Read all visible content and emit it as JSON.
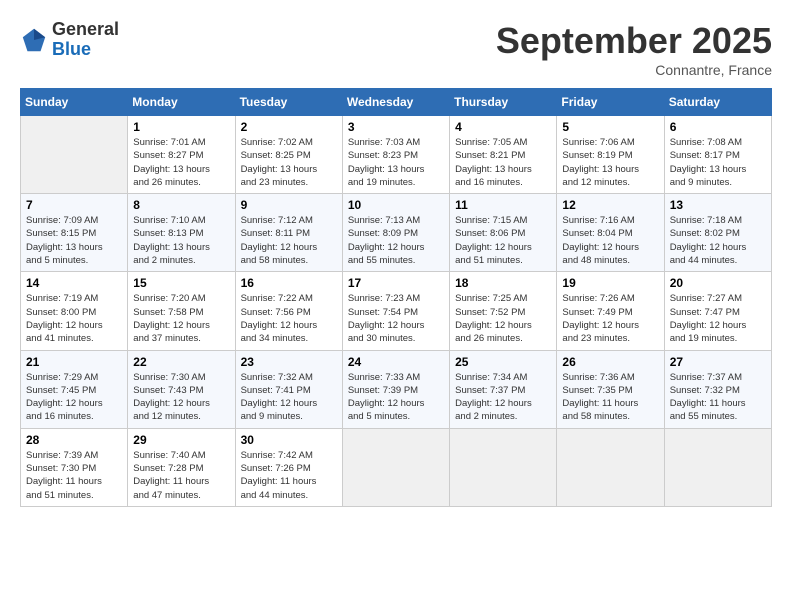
{
  "header": {
    "logo": {
      "general": "General",
      "blue": "Blue"
    },
    "title": "September 2025",
    "location": "Connantre, France"
  },
  "weekdays": [
    "Sunday",
    "Monday",
    "Tuesday",
    "Wednesday",
    "Thursday",
    "Friday",
    "Saturday"
  ],
  "weeks": [
    [
      {
        "day": "",
        "info": ""
      },
      {
        "day": "1",
        "info": "Sunrise: 7:01 AM\nSunset: 8:27 PM\nDaylight: 13 hours\nand 26 minutes."
      },
      {
        "day": "2",
        "info": "Sunrise: 7:02 AM\nSunset: 8:25 PM\nDaylight: 13 hours\nand 23 minutes."
      },
      {
        "day": "3",
        "info": "Sunrise: 7:03 AM\nSunset: 8:23 PM\nDaylight: 13 hours\nand 19 minutes."
      },
      {
        "day": "4",
        "info": "Sunrise: 7:05 AM\nSunset: 8:21 PM\nDaylight: 13 hours\nand 16 minutes."
      },
      {
        "day": "5",
        "info": "Sunrise: 7:06 AM\nSunset: 8:19 PM\nDaylight: 13 hours\nand 12 minutes."
      },
      {
        "day": "6",
        "info": "Sunrise: 7:08 AM\nSunset: 8:17 PM\nDaylight: 13 hours\nand 9 minutes."
      }
    ],
    [
      {
        "day": "7",
        "info": "Sunrise: 7:09 AM\nSunset: 8:15 PM\nDaylight: 13 hours\nand 5 minutes."
      },
      {
        "day": "8",
        "info": "Sunrise: 7:10 AM\nSunset: 8:13 PM\nDaylight: 13 hours\nand 2 minutes."
      },
      {
        "day": "9",
        "info": "Sunrise: 7:12 AM\nSunset: 8:11 PM\nDaylight: 12 hours\nand 58 minutes."
      },
      {
        "day": "10",
        "info": "Sunrise: 7:13 AM\nSunset: 8:09 PM\nDaylight: 12 hours\nand 55 minutes."
      },
      {
        "day": "11",
        "info": "Sunrise: 7:15 AM\nSunset: 8:06 PM\nDaylight: 12 hours\nand 51 minutes."
      },
      {
        "day": "12",
        "info": "Sunrise: 7:16 AM\nSunset: 8:04 PM\nDaylight: 12 hours\nand 48 minutes."
      },
      {
        "day": "13",
        "info": "Sunrise: 7:18 AM\nSunset: 8:02 PM\nDaylight: 12 hours\nand 44 minutes."
      }
    ],
    [
      {
        "day": "14",
        "info": "Sunrise: 7:19 AM\nSunset: 8:00 PM\nDaylight: 12 hours\nand 41 minutes."
      },
      {
        "day": "15",
        "info": "Sunrise: 7:20 AM\nSunset: 7:58 PM\nDaylight: 12 hours\nand 37 minutes."
      },
      {
        "day": "16",
        "info": "Sunrise: 7:22 AM\nSunset: 7:56 PM\nDaylight: 12 hours\nand 34 minutes."
      },
      {
        "day": "17",
        "info": "Sunrise: 7:23 AM\nSunset: 7:54 PM\nDaylight: 12 hours\nand 30 minutes."
      },
      {
        "day": "18",
        "info": "Sunrise: 7:25 AM\nSunset: 7:52 PM\nDaylight: 12 hours\nand 26 minutes."
      },
      {
        "day": "19",
        "info": "Sunrise: 7:26 AM\nSunset: 7:49 PM\nDaylight: 12 hours\nand 23 minutes."
      },
      {
        "day": "20",
        "info": "Sunrise: 7:27 AM\nSunset: 7:47 PM\nDaylight: 12 hours\nand 19 minutes."
      }
    ],
    [
      {
        "day": "21",
        "info": "Sunrise: 7:29 AM\nSunset: 7:45 PM\nDaylight: 12 hours\nand 16 minutes."
      },
      {
        "day": "22",
        "info": "Sunrise: 7:30 AM\nSunset: 7:43 PM\nDaylight: 12 hours\nand 12 minutes."
      },
      {
        "day": "23",
        "info": "Sunrise: 7:32 AM\nSunset: 7:41 PM\nDaylight: 12 hours\nand 9 minutes."
      },
      {
        "day": "24",
        "info": "Sunrise: 7:33 AM\nSunset: 7:39 PM\nDaylight: 12 hours\nand 5 minutes."
      },
      {
        "day": "25",
        "info": "Sunrise: 7:34 AM\nSunset: 7:37 PM\nDaylight: 12 hours\nand 2 minutes."
      },
      {
        "day": "26",
        "info": "Sunrise: 7:36 AM\nSunset: 7:35 PM\nDaylight: 11 hours\nand 58 minutes."
      },
      {
        "day": "27",
        "info": "Sunrise: 7:37 AM\nSunset: 7:32 PM\nDaylight: 11 hours\nand 55 minutes."
      }
    ],
    [
      {
        "day": "28",
        "info": "Sunrise: 7:39 AM\nSunset: 7:30 PM\nDaylight: 11 hours\nand 51 minutes."
      },
      {
        "day": "29",
        "info": "Sunrise: 7:40 AM\nSunset: 7:28 PM\nDaylight: 11 hours\nand 47 minutes."
      },
      {
        "day": "30",
        "info": "Sunrise: 7:42 AM\nSunset: 7:26 PM\nDaylight: 11 hours\nand 44 minutes."
      },
      {
        "day": "",
        "info": ""
      },
      {
        "day": "",
        "info": ""
      },
      {
        "day": "",
        "info": ""
      },
      {
        "day": "",
        "info": ""
      }
    ]
  ]
}
